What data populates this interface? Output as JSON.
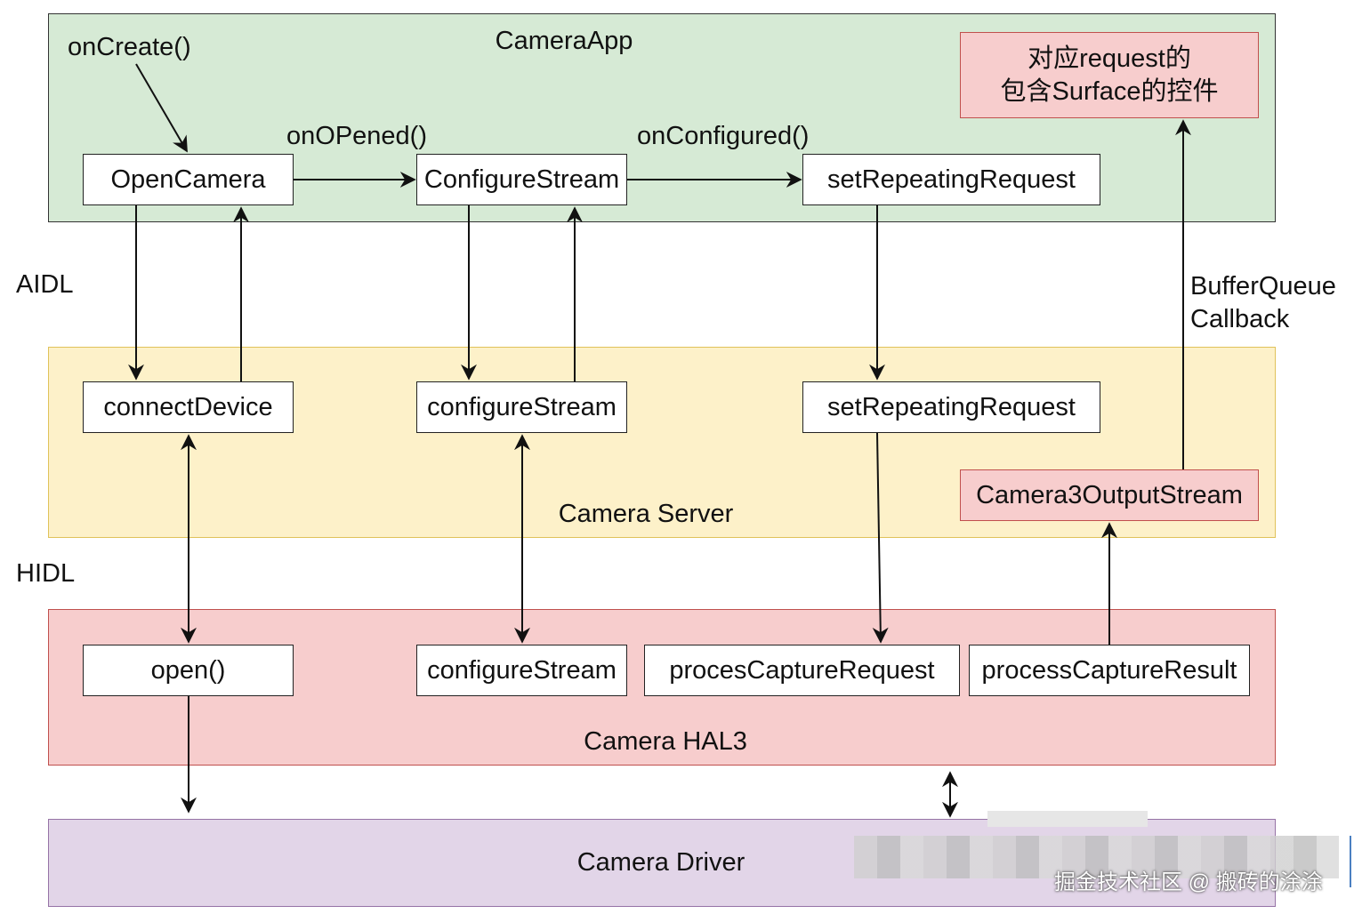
{
  "layers": {
    "app": "CameraApp",
    "server": "Camera Server",
    "hal": "Camera HAL3",
    "driver": "Camera Driver"
  },
  "interfaces": {
    "aidl": "AIDL",
    "hidl": "HIDL"
  },
  "app_boxes": {
    "open_camera": "OpenCamera",
    "configure_stream": "ConfigureStream",
    "set_repeating_request": "setRepeatingRequest"
  },
  "callbacks": {
    "on_create": "onCreate()",
    "on_opened": "onOPened()",
    "on_configured": "onConfigured()",
    "buffer_queue_line1": "BufferQueue",
    "buffer_queue_line2": "Callback"
  },
  "note": {
    "line1": "对应request的",
    "line2": "包含Surface的控件"
  },
  "server_boxes": {
    "connect_device": "connectDevice",
    "configure_stream": "configureStream",
    "set_repeating_request": "setRepeatingRequest",
    "output_stream": "Camera3OutputStream"
  },
  "hal_boxes": {
    "open": "open()",
    "configure_stream": "configureStream",
    "process_capture_request": "procesCaptureRequest",
    "process_capture_result": "processCaptureResult"
  },
  "watermark": "掘金技术社区 @ 搬砖的涂涂"
}
